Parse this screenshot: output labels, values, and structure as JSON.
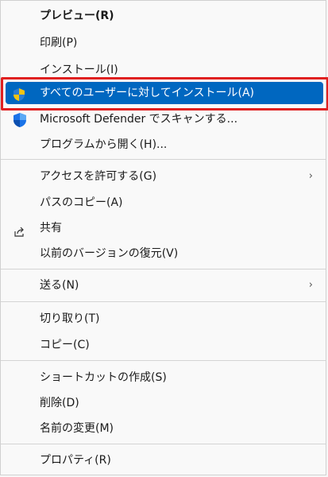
{
  "menu": {
    "items": [
      {
        "label": "プレビュー(R)"
      },
      {
        "label": "印刷(P)"
      },
      {
        "label": "インストール(I)"
      },
      {
        "label": "すべてのユーザーに対してインストール(A)"
      },
      {
        "label": "Microsoft Defender でスキャンする..."
      },
      {
        "label": "プログラムから開く(H)..."
      },
      {
        "label": "アクセスを許可する(G)"
      },
      {
        "label": "パスのコピー(A)"
      },
      {
        "label": "共有"
      },
      {
        "label": "以前のバージョンの復元(V)"
      },
      {
        "label": "送る(N)"
      },
      {
        "label": "切り取り(T)"
      },
      {
        "label": "コピー(C)"
      },
      {
        "label": "ショートカットの作成(S)"
      },
      {
        "label": "削除(D)"
      },
      {
        "label": "名前の変更(M)"
      },
      {
        "label": "プロパティ(R)"
      }
    ],
    "submenu_arrow": "›"
  },
  "colors": {
    "selection": "#0067c0",
    "highlight_outline": "#e02020",
    "defender_shield": "#1a73e8",
    "uac_shield_yellow": "#f3c313",
    "uac_shield_blue": "#2b7cd3"
  },
  "icons": [
    "uac-shield-icon",
    "defender-shield-icon",
    "share-icon",
    "chevron-right-icon"
  ]
}
